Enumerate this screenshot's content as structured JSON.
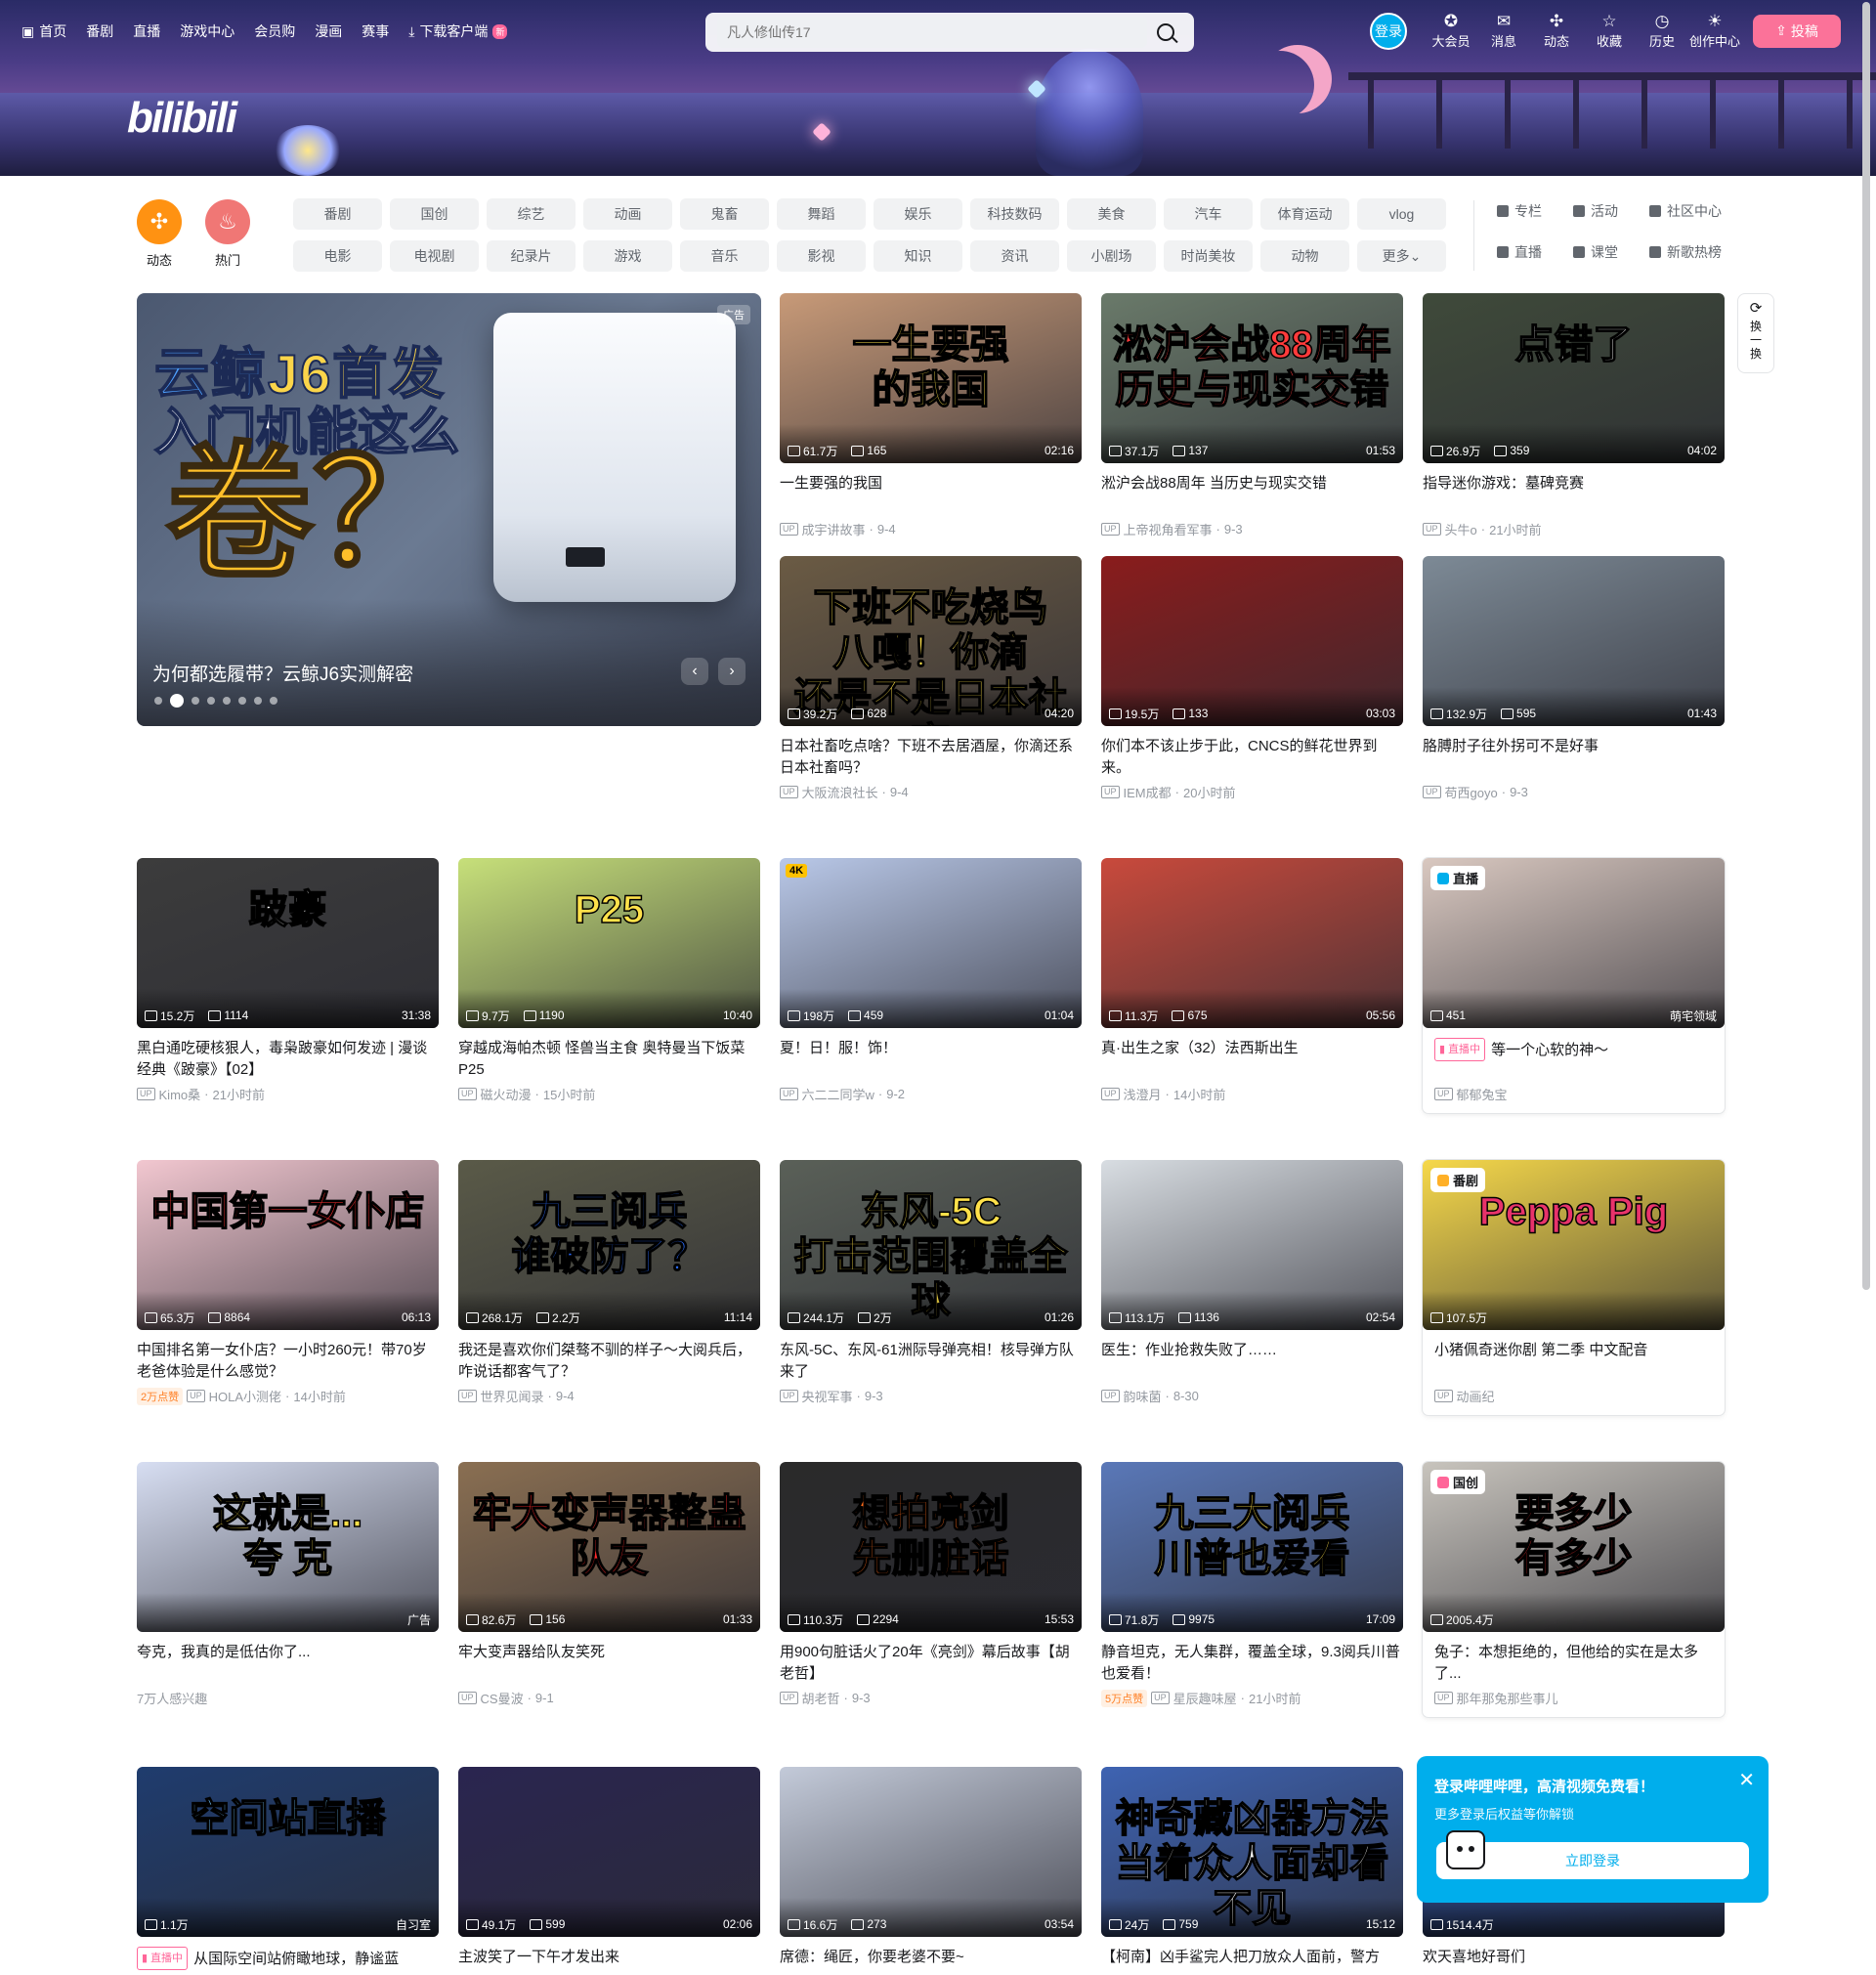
{
  "nav": {
    "items": [
      "首页",
      "番剧",
      "直播",
      "游戏中心",
      "会员购",
      "漫画",
      "赛事"
    ],
    "download": "下载客户端",
    "download_badge": "新"
  },
  "logo": "bilibili",
  "search": {
    "placeholder": "凡人修仙传17"
  },
  "user": {
    "login": "登录",
    "links": [
      {
        "label": "大会员",
        "icon": "vip-icon"
      },
      {
        "label": "消息",
        "icon": "message-icon"
      },
      {
        "label": "动态",
        "icon": "dynamic-icon"
      },
      {
        "label": "收藏",
        "icon": "favorite-icon"
      },
      {
        "label": "历史",
        "icon": "history-icon"
      },
      {
        "label": "创作中心",
        "icon": "creator-icon"
      }
    ],
    "upload": "投稿"
  },
  "channels": {
    "round": [
      {
        "label": "动态",
        "color": "#ff9212"
      },
      {
        "label": "热门",
        "color": "#f07775"
      }
    ],
    "chips": [
      "番剧",
      "国创",
      "综艺",
      "动画",
      "鬼畜",
      "舞蹈",
      "娱乐",
      "科技数码",
      "美食",
      "汽车",
      "体育运动",
      "vlog",
      "电影",
      "电视剧",
      "纪录片",
      "游戏",
      "音乐",
      "影视",
      "知识",
      "资讯",
      "小剧场",
      "时尚美妆",
      "动物",
      "更多"
    ],
    "side": [
      "专栏",
      "活动",
      "社区中心",
      "直播",
      "课堂",
      "新歌热榜"
    ]
  },
  "carousel": {
    "headline_a": "云鲸",
    "headline_b": "J6首发",
    "headline_c": "入门机能这么",
    "headline_d": "卷？",
    "caption": "为何都选履带？云鲸J6实测解密",
    "ad": "广告",
    "dots": 8,
    "active_dot": 1
  },
  "refresh": {
    "label_a": "换",
    "label_b": "一",
    "label_c": "换"
  },
  "cards": [
    {
      "title": "一生要强的我国",
      "views": "61.7万",
      "danmaku": "165",
      "dur": "02:16",
      "up": "成宇讲故事",
      "date": "9-4",
      "art": "一生要强\n的我国",
      "bg": "#c89a78",
      "fg": "#fde14a"
    },
    {
      "title": "淞沪会战88周年 当历史与现实交错",
      "views": "37.1万",
      "danmaku": "137",
      "dur": "01:53",
      "up": "上帝视角看军事",
      "date": "9-3",
      "art": "淞沪会战88周年\n历史与现实交错",
      "bg": "#6a7a6a",
      "fg": "#ff3b3b"
    },
    {
      "title": "指导迷你游戏：墓碑竞赛",
      "views": "26.9万",
      "danmaku": "359",
      "dur": "04:02",
      "up": "头牛o",
      "date": "21小时前",
      "art": "点错了",
      "bg": "#3f4a3a",
      "fg": "#ffffff"
    },
    {
      "title": "日本社畜吃点啥？下班不去居酒屋，你滴还系日本社畜吗？",
      "views": "39.2万",
      "danmaku": "628",
      "dur": "04:20",
      "up": "大阪流浪社长",
      "date": "9-4",
      "art": "下班不吃烧鸟\n八嘎！你滴\n还是不是日本社畜",
      "bg": "#6b5b44",
      "fg": "#ffe14a"
    },
    {
      "title": "你们本不该止步于此，CNCS的鲜花世界到来。",
      "views": "19.5万",
      "danmaku": "133",
      "dur": "03:03",
      "up": "IEM成都",
      "date": "20小时前",
      "art": "",
      "bg": "#8a1c1c",
      "fg": "#ffffff"
    },
    {
      "title": "胳膊肘子往外拐可不是好事",
      "views": "132.9万",
      "danmaku": "595",
      "dur": "01:43",
      "up": "苟西goyo",
      "date": "9-3",
      "art": "",
      "bg": "#7d8a96",
      "fg": "#ffffff"
    },
    {
      "title": "黑白通吃硬核狠人，毒枭跛豪如何发迹 | 漫谈经典《跛豪》【02】",
      "views": "15.2万",
      "danmaku": "1114",
      "dur": "31:38",
      "up": "Kimo桑",
      "date": "21小时前",
      "art": "跛豪",
      "bg": "#3c3c3c",
      "fg": "#ffffff"
    },
    {
      "title": "穿越成海帕杰顿 怪兽当主食 奥特曼当下饭菜P25",
      "views": "9.7万",
      "danmaku": "1190",
      "dur": "10:40",
      "up": "磁火动漫",
      "date": "15小时前",
      "art": "P25",
      "bg": "#c7e07a",
      "fg": "#ffe14a"
    },
    {
      "title": "夏！日！服！饰！",
      "views": "198万",
      "danmaku": "459",
      "dur": "01:04",
      "up": "六二二同学w",
      "date": "9-2",
      "art": "",
      "bg": "#b9c8e8",
      "fg": "#ffffff",
      "k4": "4K"
    },
    {
      "title": "真·出生之家（32）法西斯出生",
      "views": "11.3万",
      "danmaku": "675",
      "dur": "05:56",
      "up": "浅澄月",
      "date": "14小时前",
      "art": "",
      "bg": "#c94a3c",
      "fg": "#ffffff"
    },
    {
      "title": "等一个心软的神～",
      "live": "直播中",
      "views": "451",
      "tag": "萌宅领域",
      "up": "郁郁兔宝",
      "badge": "直播",
      "bg": "#d9c8c0",
      "boxed": true
    },
    {
      "title": "中国排名第一女仆店？一小时260元！带70岁老爸体验是什么感觉？",
      "views": "65.3万",
      "danmaku": "8864",
      "dur": "06:13",
      "up": "HOLA小测佬",
      "date": "14小时前",
      "like": "2万点赞",
      "art": "中国第一女仆店",
      "bg": "#f2c7d0",
      "fg": "#ff3030"
    },
    {
      "title": "我还是喜欢你们桀骜不驯的样子～大阅兵后，咋说话都客气了？",
      "views": "268.1万",
      "danmaku": "2.2万",
      "dur": "11:14",
      "up": "世界见闻录",
      "date": "9-4",
      "art": "九三阅兵\n谁破防了？",
      "bg": "#5a5a48",
      "fg": "#2b6dff"
    },
    {
      "title": "东风-5C、东风-61洲际导弹亮相！核导弹方队来了",
      "views": "244.1万",
      "danmaku": "2万",
      "dur": "01:26",
      "up": "央视军事",
      "date": "9-3",
      "art": "东风-5C\n打击范围覆盖全球",
      "bg": "#5a6058",
      "fg": "#ffe14a"
    },
    {
      "title": "医生：作业抢救失败了……",
      "views": "113.1万",
      "danmaku": "1136",
      "dur": "02:54",
      "up": "韵味菌",
      "date": "8-30",
      "art": "",
      "bg": "#d8dde2",
      "fg": "#ffffff"
    },
    {
      "title": "小猪佩奇迷你剧 第二季 中文配音",
      "views": "107.5万",
      "up": "动画纪",
      "badge": "番剧",
      "bg": "#f6d84a",
      "art": "Peppa Pig",
      "fg": "#e8336b",
      "boxed": true
    },
    {
      "title": "夸克，我真的是低估你了...",
      "ad": "广告",
      "sub": "7万人感兴趣",
      "art": "这就是...\n夸 克",
      "bg": "#d7def2",
      "fg": "#ffe14a"
    },
    {
      "title": "牢大变声器给队友笑死",
      "views": "82.6万",
      "danmaku": "156",
      "dur": "01:33",
      "up": "CS曼波",
      "date": "9-1",
      "art": "牢大变声器整蛊队友",
      "bg": "#8a6f52",
      "fg": "#ff2a2a"
    },
    {
      "title": "用900句脏话火了20年《亮剑》幕后故事【胡老哲】",
      "views": "110.3万",
      "danmaku": "2294",
      "dur": "15:53",
      "up": "胡老哲",
      "date": "9-3",
      "art": "想拍亮剑\n先删脏话",
      "bg": "#2a2a2a",
      "fg": "#ff6a1a"
    },
    {
      "title": "静音坦克，无人集群，覆盖全球，9.3阅兵川普也爱看！",
      "views": "71.8万",
      "danmaku": "9975",
      "dur": "17:09",
      "up": "星辰趣味屋",
      "date": "21小时前",
      "like": "5万点赞",
      "art": "九三大阅兵\n川普也爱看",
      "bg": "#5a78b8",
      "fg": "#ffe14a"
    },
    {
      "title": "兔子：本想拒绝的，但他给的实在是太多了...",
      "views": "2005.4万",
      "up": "那年那兔那些事儿",
      "badge": "国创",
      "art": "要多少\n有多少",
      "bg": "#c8c4bd",
      "fg": "#ff3333",
      "boxed": true
    },
    {
      "title": "从国际空间站俯瞰地球，静谧蓝",
      "live": "直播中",
      "views": "1.1万",
      "tag": "自习室",
      "art": "空间站直播",
      "bg": "#1f3c6e",
      "fg": "#74c6ff"
    },
    {
      "title": "主波笑了一下午才发出来",
      "views": "49.1万",
      "danmaku": "599",
      "dur": "02:06",
      "art": "",
      "bg": "#2a2550",
      "fg": "#ffffff"
    },
    {
      "title": "席德：绳匠，你要老婆不要~",
      "views": "16.6万",
      "danmaku": "273",
      "dur": "03:54",
      "art": "",
      "bg": "#c3cad9",
      "fg": "#ffffff"
    },
    {
      "title": "【柯南】凶手鲨完人把刀放众人面前，警方",
      "views": "24万",
      "danmaku": "759",
      "dur": "15:12",
      "art": "神奇藏凶器方法\n当着众人面却看不见",
      "bg": "#3e63b2",
      "fg": "#ffffff"
    },
    {
      "title": "欢天喜地好哥们",
      "views": "1514.4万",
      "art": "",
      "bg": "#2a4fa0",
      "fg": "#ffffff"
    }
  ],
  "popup": {
    "title": "登录哔哩哔哩，高清视频免费看！",
    "sub": "更多登录后权益等你解锁",
    "button": "立即登录"
  }
}
